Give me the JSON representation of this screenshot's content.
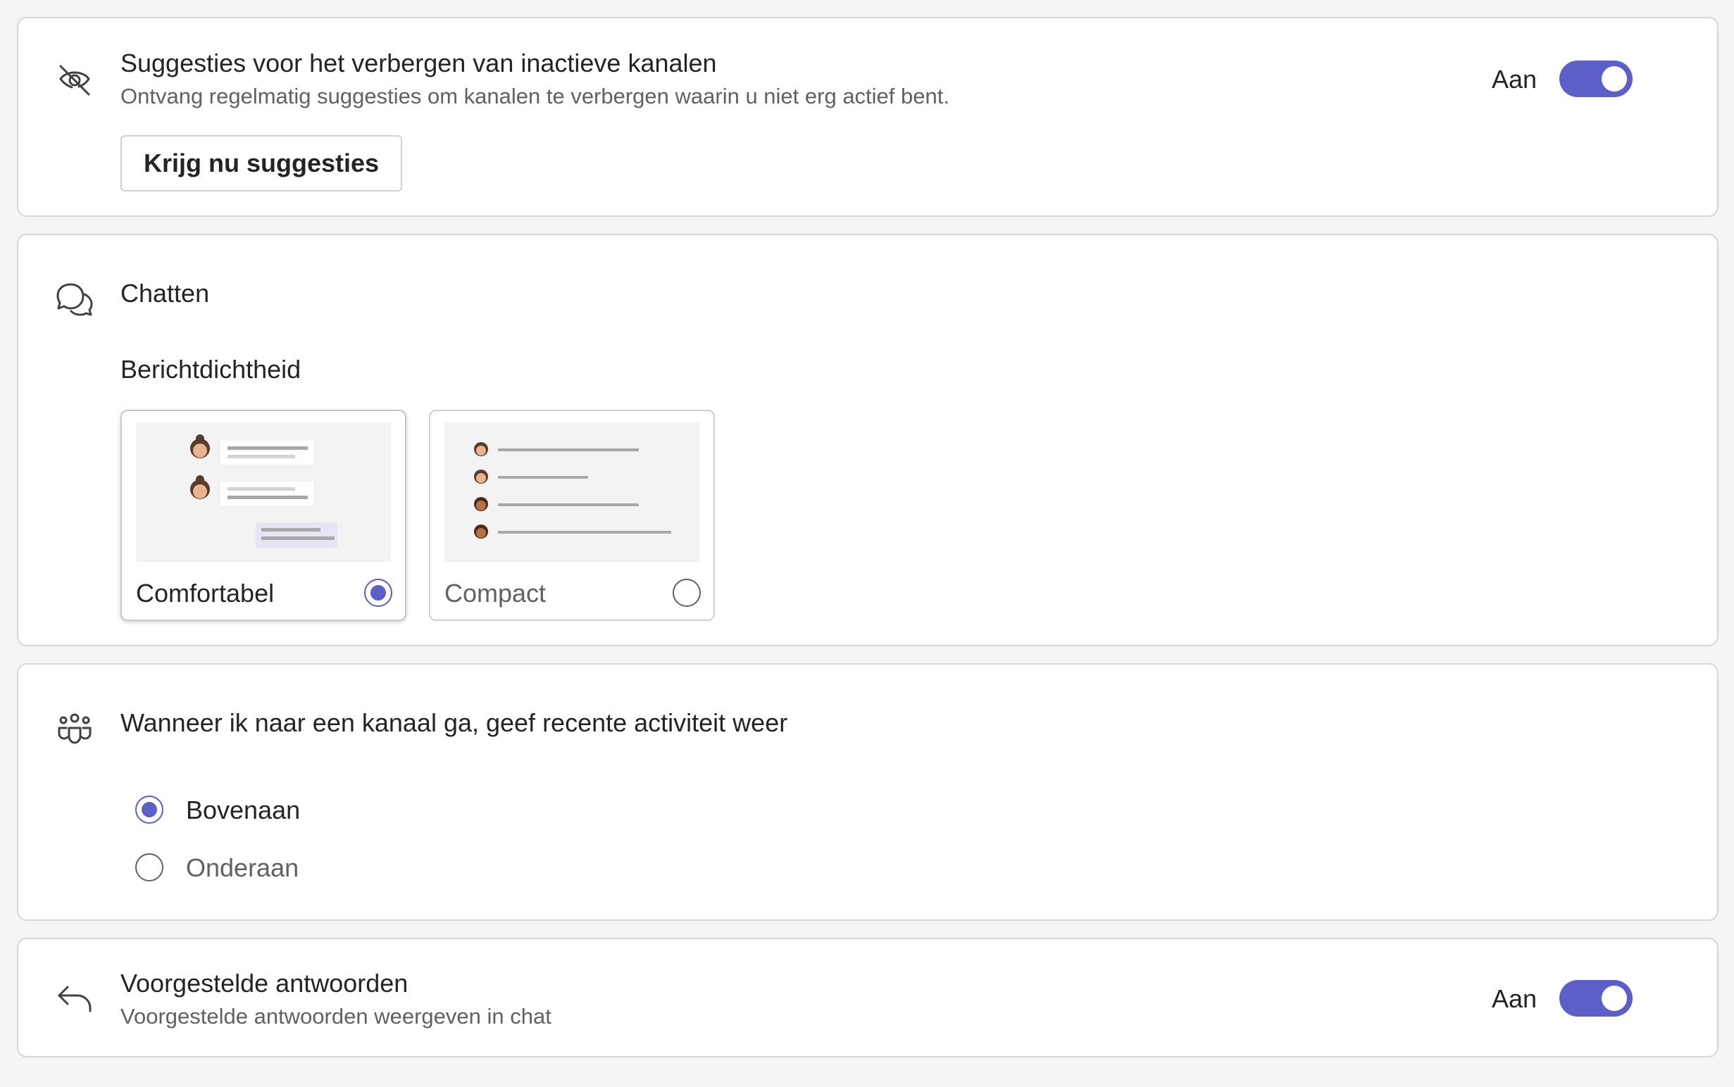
{
  "hide_channels": {
    "title": "Suggesties voor het verbergen van inactieve kanalen",
    "description": "Ontvang regelmatig suggesties om kanalen te verbergen waarin u niet erg actief bent.",
    "toggle_label": "Aan",
    "toggle_on": true,
    "button_label": "Krijg nu suggesties",
    "icon": "eye-off-icon"
  },
  "chat": {
    "title": "Chatten",
    "icon": "chat-bubbles-icon",
    "density_heading": "Berichtdichtheid",
    "options": [
      {
        "label": "Comfortabel",
        "selected": true
      },
      {
        "label": "Compact",
        "selected": false
      }
    ]
  },
  "channel_activity": {
    "title": "Wanneer ik naar een kanaal ga, geef recente activiteit weer",
    "icon": "people-group-icon",
    "options": [
      {
        "label": "Bovenaan",
        "selected": true
      },
      {
        "label": "Onderaan",
        "selected": false
      }
    ]
  },
  "suggested_replies": {
    "title": "Voorgestelde antwoorden",
    "description": "Voorgestelde antwoorden weergeven in chat",
    "toggle_label": "Aan",
    "toggle_on": true,
    "icon": "reply-arrow-icon"
  },
  "colors": {
    "accent": "#5b5fc7",
    "card_border": "#d6d6d6",
    "muted_text": "#616161"
  }
}
